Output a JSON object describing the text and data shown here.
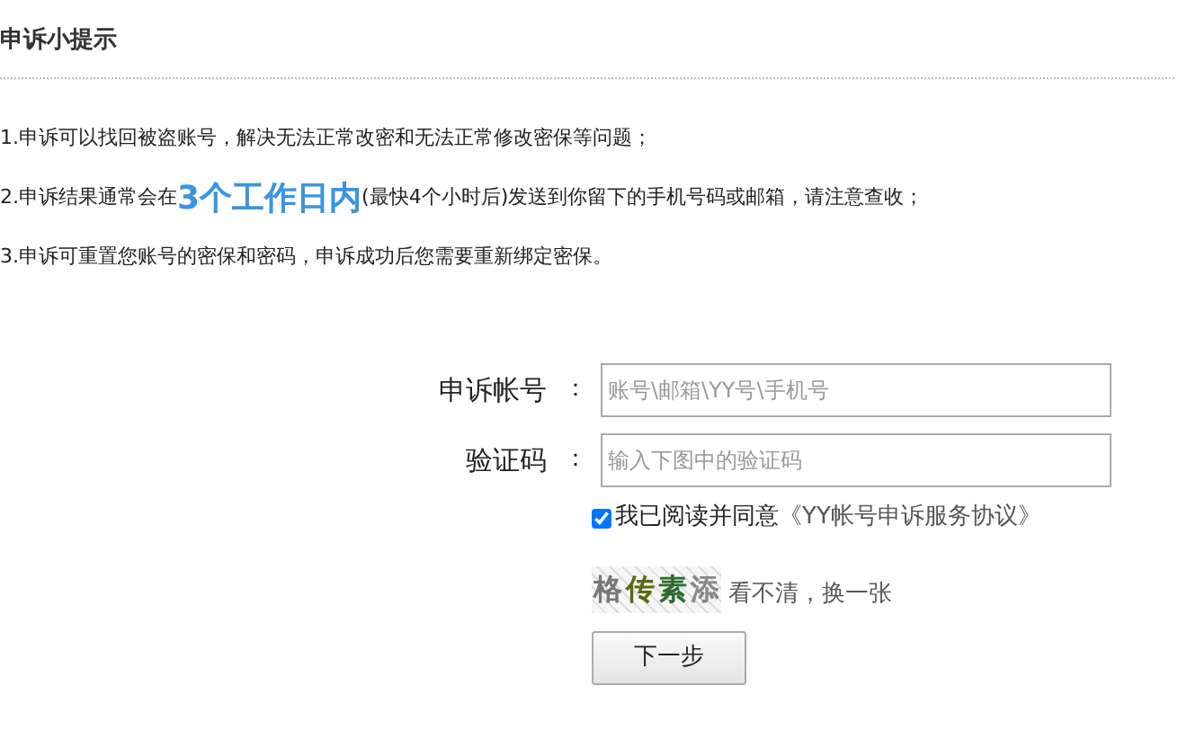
{
  "title": "申诉小提示",
  "tips": [
    {
      "parts": [
        {
          "text": "1.申诉可以找回被盗账号，解决无法正常改密和无法正常修改密保等问题；",
          "kind": "plain"
        }
      ]
    },
    {
      "parts": [
        {
          "text": "2.申诉结果通常会在",
          "kind": "plain"
        },
        {
          "text": "3个工作日内",
          "kind": "highlight"
        },
        {
          "text": "(最快4个小时后)发送到你留下的手机号码或邮箱，请注意查收；",
          "kind": "plain"
        }
      ]
    },
    {
      "parts": [
        {
          "text": "3.申诉可重置您账号的密保和密码，申诉成功后您需要重新绑定密保。",
          "kind": "plain"
        }
      ]
    }
  ],
  "form": {
    "fields": [
      {
        "label": "申诉帐号",
        "colon": "：",
        "placeholder": "账号\\邮箱\\YY号\\手机号"
      },
      {
        "label": "验证码",
        "colon": "：",
        "placeholder": "输入下图中的验证码"
      }
    ],
    "agreement": {
      "checked": true,
      "text": "我已阅读并同意",
      "link": "《YY帐号申诉服务协议》"
    },
    "captcha": {
      "characters": [
        "格",
        "传",
        "素",
        "添"
      ],
      "refresh": "看不清，换一张"
    },
    "submit": "下一步"
  }
}
